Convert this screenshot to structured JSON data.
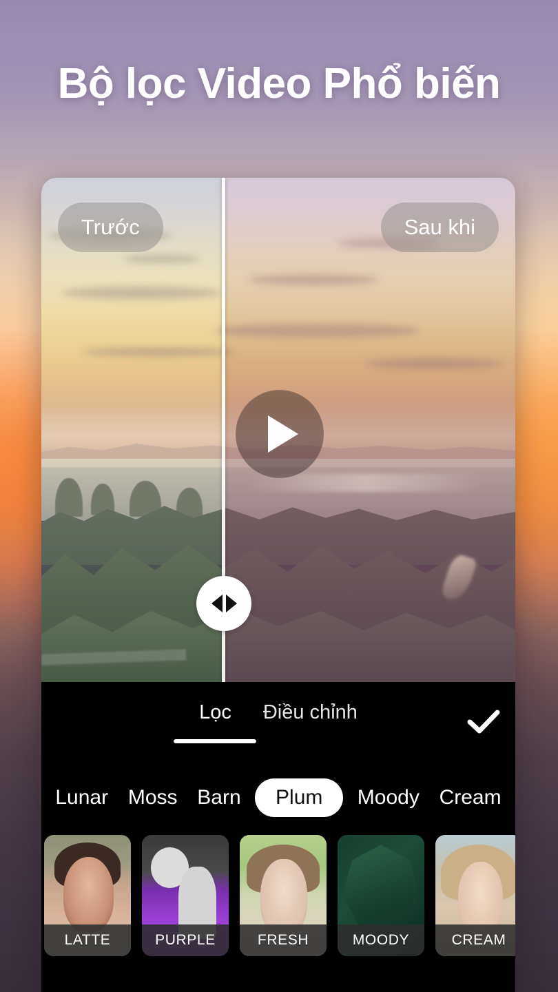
{
  "header": {
    "title": "Bộ lọc Video Phổ biến"
  },
  "preview": {
    "before_label": "Trước",
    "after_label": "Sau khi",
    "play_icon": "play-icon",
    "split_handle_icon": "left-right-arrows-icon",
    "split_position_percent": 38
  },
  "editor": {
    "tabs": [
      {
        "label": "Lọc",
        "active": true
      },
      {
        "label": "Điều chỉnh",
        "active": false
      }
    ],
    "confirm_icon": "check-icon",
    "filters": [
      {
        "label": "Lunar",
        "selected": false
      },
      {
        "label": "Moss",
        "selected": false
      },
      {
        "label": "Barn",
        "selected": false
      },
      {
        "label": "Plum",
        "selected": true
      },
      {
        "label": "Moody",
        "selected": false
      },
      {
        "label": "Cream",
        "selected": false
      }
    ],
    "presets": [
      {
        "label": "LATTE",
        "art": "art-latte"
      },
      {
        "label": "PURPLE",
        "art": "art-purple"
      },
      {
        "label": "FRESH",
        "art": "art-fresh"
      },
      {
        "label": "MOODY",
        "art": "art-moody"
      },
      {
        "label": "CREAM",
        "art": "art-cream"
      }
    ]
  },
  "colors": {
    "panel_background": "#000000",
    "accent_white": "#ffffff",
    "selected_pill_bg": "#ffffff",
    "selected_pill_text": "#111111",
    "thumb_label_bg": "#2d2d2d",
    "background_top": "#9589b0",
    "background_mid": "#ef9550",
    "background_bottom": "#392f3b"
  }
}
